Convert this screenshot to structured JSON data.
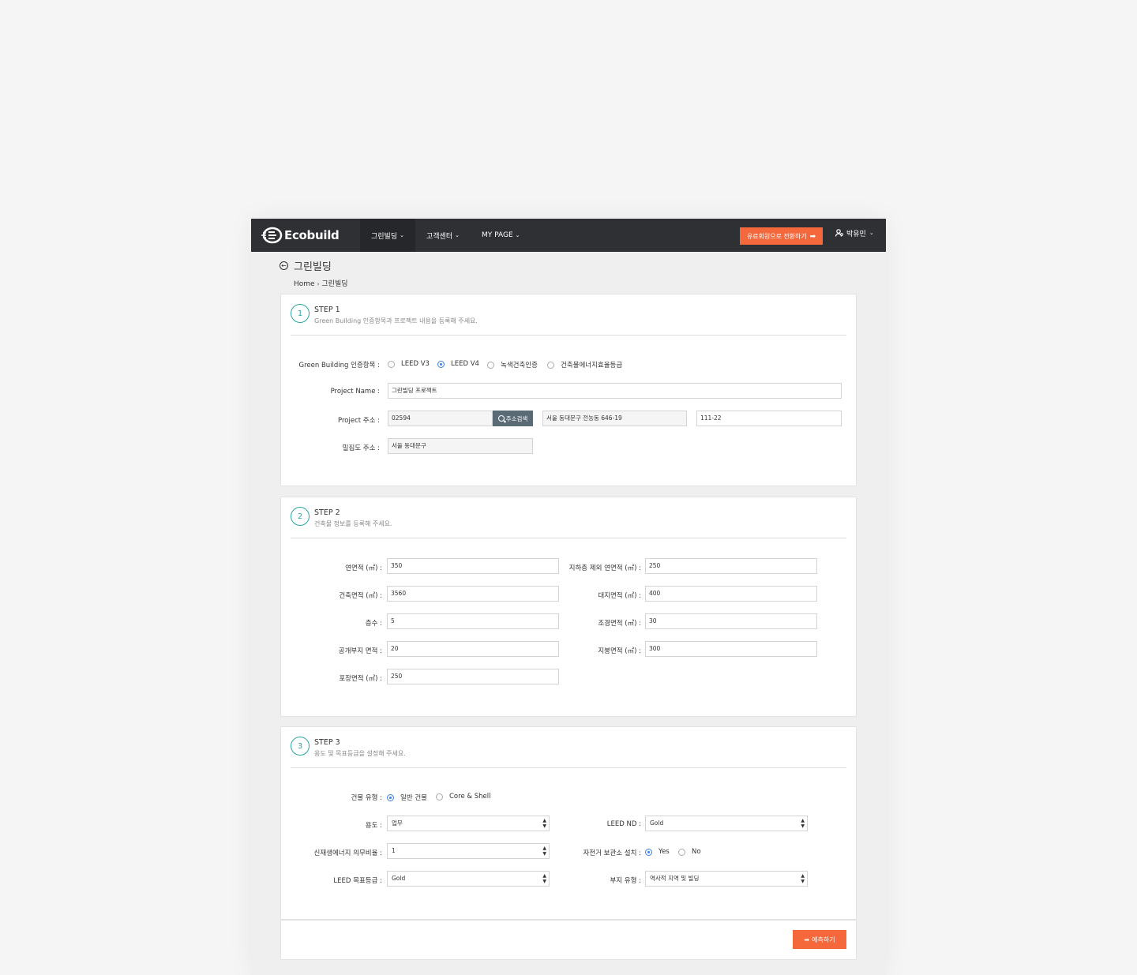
{
  "nav": {
    "logo_text": "Ecobuild",
    "menu": [
      {
        "label": "그린빌딩"
      },
      {
        "label": "고객센터"
      },
      {
        "label": "MY PAGE"
      }
    ],
    "upgrade_label": "유료회원으로 전환하기",
    "user_name": "박유민"
  },
  "page": {
    "title": "그린빌딩",
    "breadcrumb": [
      "Home",
      "그린빌딩"
    ]
  },
  "step1": {
    "num": "1",
    "title": "STEP 1",
    "subtitle": "Green Building 인증항목과 프로젝트 내용을 등록해 주세요.",
    "cert_label": "Green Building 인증항목 :",
    "cert_options": [
      "LEED V3",
      "LEED V4",
      "녹색건축인증",
      "건축물에너지효율등급"
    ],
    "cert_selected": "LEED V4",
    "project_name_label": "Project Name :",
    "project_name_value": "그린빌딩 프로젝트",
    "address_label": "Project 주소 :",
    "zip_value": "02594",
    "search_label": "주소검색",
    "address_value": "서울 동대문구 전농동 646-19",
    "address_detail_value": "111-22",
    "density_label": "밀집도 주소 :",
    "density_value": "서울 동대문구"
  },
  "step2": {
    "num": "2",
    "title": "STEP 2",
    "subtitle": "건축물 정보를 등록해 주세요.",
    "fields_left": [
      {
        "label": "연면적 (㎡) :",
        "value": "350"
      },
      {
        "label": "건축면적 (㎡) :",
        "value": "3560"
      },
      {
        "label": "층수 :",
        "value": "5"
      },
      {
        "label": "공개부지 면적 :",
        "value": "20"
      },
      {
        "label": "포장면적 (㎡) :",
        "value": "250"
      }
    ],
    "fields_right": [
      {
        "label": "지하층 제외 연면적 (㎡) :",
        "value": "250"
      },
      {
        "label": "대지면적 (㎡) :",
        "value": "400"
      },
      {
        "label": "조경면적 (㎡) :",
        "value": "30"
      },
      {
        "label": "지붕면적 (㎡) :",
        "value": "300"
      }
    ]
  },
  "step3": {
    "num": "3",
    "title": "STEP 3",
    "subtitle": "용도 및 목표등급을 설정해 주세요.",
    "building_type_label": "건물 유형 :",
    "building_type_options": [
      "일반 건물",
      "Core & Shell"
    ],
    "building_type_selected": "일반 건물",
    "use_label": "용도 :",
    "use_value": "업무",
    "leed_nd_label": "LEED ND :",
    "leed_nd_value": "Gold",
    "renewable_label": "신재생에너지 의무비율 :",
    "renewable_value": "1",
    "bike_label": "자전거 보관소 설치 :",
    "bike_options": [
      "Yes",
      "No"
    ],
    "bike_selected": "Yes",
    "target_label": "LEED 목표등급 :",
    "target_value": "Gold",
    "site_type_label": "부지 유형 :",
    "site_type_value": "역사적 지역 및 빌딩"
  },
  "footer": {
    "predict_label": "예측하기"
  },
  "colors": {
    "nav_bg": "#2e3034",
    "accent": "#f4683b",
    "step_teal": "#2aa5a0",
    "radio_blue": "#3a80e8",
    "search_btn": "#5b6b76"
  }
}
